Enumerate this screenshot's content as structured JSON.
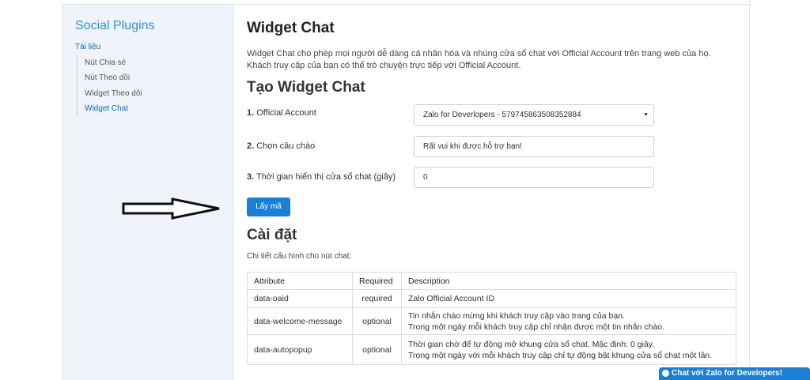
{
  "sidebar": {
    "title": "Social Plugins",
    "section": "Tài liệu",
    "items": [
      {
        "label": "Nút Chia sẻ"
      },
      {
        "label": "Nút Theo dõi"
      },
      {
        "label": "Widget Theo dõi"
      },
      {
        "label": "Widget Chat"
      }
    ],
    "active_item": "Widget Chat"
  },
  "main": {
    "title": "Widget Chat",
    "intro": "Widget Chat cho phép mọi người dễ dàng cá nhân hóa và nhúng cửa sổ chat với Official Account trên trang web của họ. Khách truy cập của bạn có thể trò chuyện trực tiếp với Official Account.",
    "create_heading": "Tạo Widget Chat",
    "form": {
      "oa_num": "1.",
      "oa_label": "Official Account",
      "oa_value": "Zalo for Deverlopers - 579745863508352884",
      "greeting_num": "2.",
      "greeting_label": "Chọn câu chào",
      "greeting_value": "Rất vui khi được hỗ trợ bạn!",
      "delay_num": "3.",
      "delay_label": "Thời gian hiển thị cửa sổ chat (giây)",
      "delay_value": "0"
    },
    "get_code_label": "Lấy mã",
    "settings_heading": "Cài đặt",
    "settings_desc": "Chi tiết cấu hình cho nút chat:",
    "table": {
      "headers": [
        "Attribute",
        "Required",
        "Description"
      ],
      "rows": [
        {
          "attribute": "data-oaid",
          "required": "required",
          "desc1": "Zalo Official Account ID",
          "desc2": ""
        },
        {
          "attribute": "data-welcome-message",
          "required": "optional",
          "desc1": "Tin nhắn chào mừng khi khách truy cập vào trang của bạn.",
          "desc2": "Trong một ngày mỗi khách truy cập chỉ nhận được một tin nhắn chào."
        },
        {
          "attribute": "data-autopopup",
          "required": "optional",
          "desc1": "Thời gian chờ để tự động mở khung cửa sổ chat. Mặc định: 0 giây.",
          "desc2": "Trong một ngày với mỗi khách truy cập chỉ tự động bật khung cửa sổ chat một lần."
        }
      ]
    }
  },
  "chat_widget_label": "Chat với Zalo for Developers!",
  "colors": {
    "accent": "#1b7fd6",
    "sidebar_bg": "#f0f4fa",
    "sidebar_title": "#2f8fd8"
  }
}
